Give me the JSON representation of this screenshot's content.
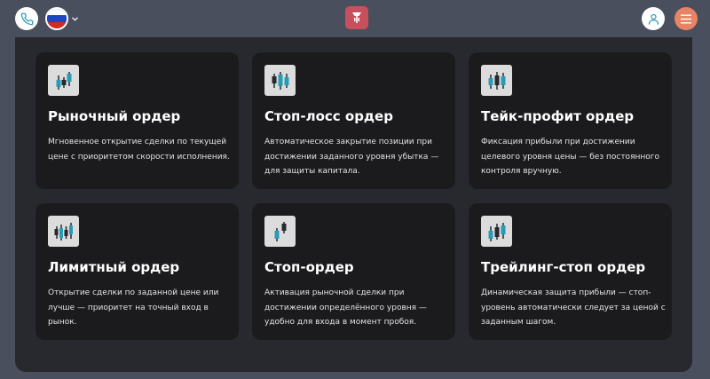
{
  "header": {
    "phone_icon": "phone-icon",
    "language_flag": "russia-flag-icon",
    "logo_icon": "brand-logo-icon",
    "user_icon": "user-icon",
    "menu_icon": "hamburger-menu-icon",
    "colors": {
      "background": "#4a4f5e",
      "logo_bg": "#c8505c",
      "menu_bg": "#e88466",
      "accent_teal": "#2a9bb5"
    }
  },
  "cards": [
    {
      "icon": "candlestick-chart-icon",
      "title": "Рыночный ордер",
      "description": "Мгновенное открытие сделки по текущей цене с приоритетом скорости исполнения."
    },
    {
      "icon": "candlestick-chart-icon",
      "title": "Стоп-лосс ордер",
      "description": "Автоматическое закрытие позиции при достижении заданного уровня убытка — для защиты капитала."
    },
    {
      "icon": "candlestick-chart-icon",
      "title": "Тейк-профит ордер",
      "description": "Фиксация прибыли при достижении целевого уровня цены — без постоянного контроля вручную."
    },
    {
      "icon": "candlestick-chart-icon",
      "title": "Лимитный ордер",
      "description": "Открытие сделки по заданной цене или лучше — приоритет на точный вход в рынок."
    },
    {
      "icon": "candlestick-chart-icon",
      "title": "Стоп-ордер",
      "description": "Активация рыночной сделки при достижении определённого уровня — удобно для входа в момент пробоя."
    },
    {
      "icon": "candlestick-chart-icon",
      "title": "Трейлинг-стоп ордер",
      "description": "Динамическая защита прибыли — стоп-уровень автоматически следует за ценой с заданным шагом."
    }
  ]
}
